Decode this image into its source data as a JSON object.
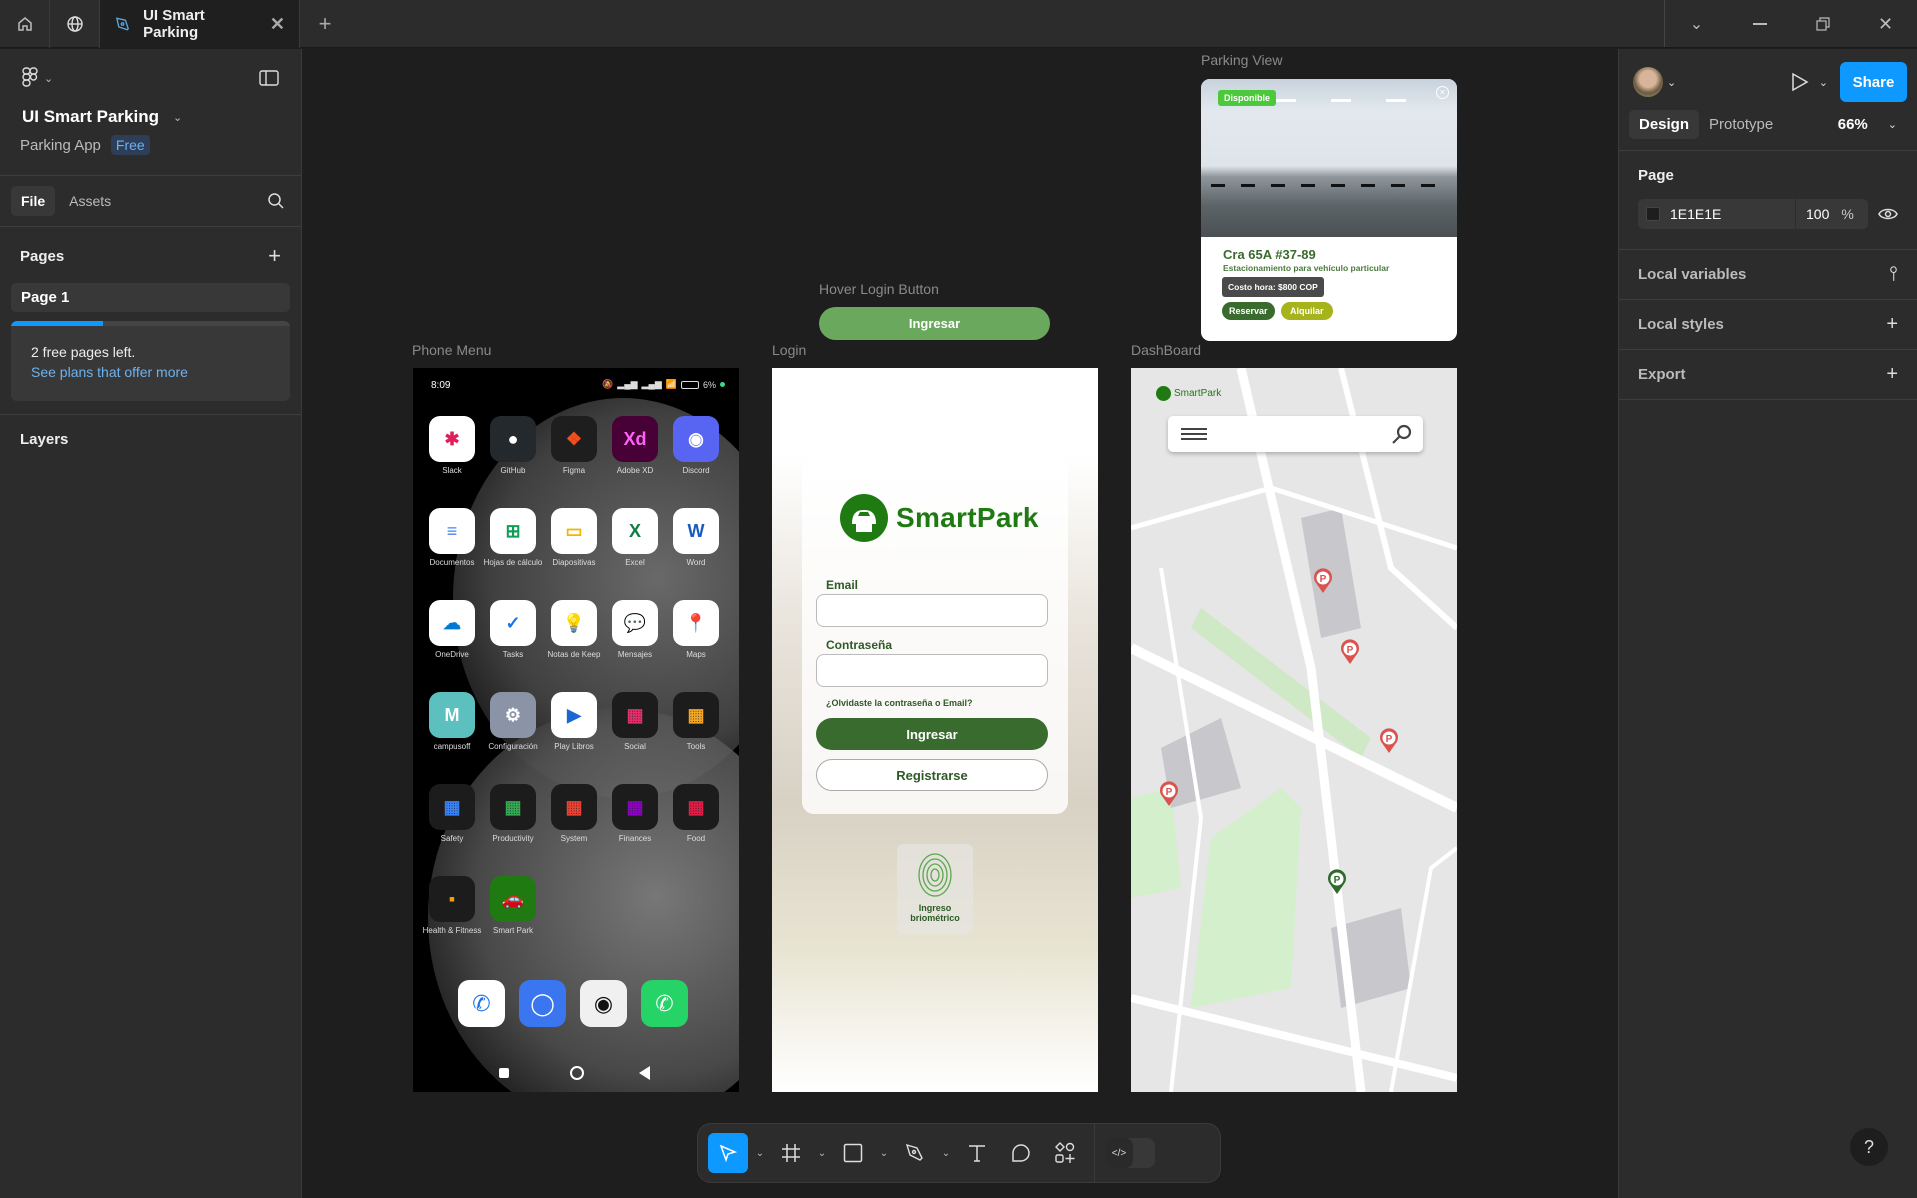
{
  "titlebar": {
    "tab_title": "UI Smart Parking",
    "icons": [
      "home-icon",
      "globe-icon",
      "pen-tool-icon",
      "close-icon",
      "plus-icon",
      "chevron-down-icon",
      "minimize-icon",
      "restore-icon",
      "close-window-icon"
    ]
  },
  "left_panel": {
    "file_name": "UI Smart Parking",
    "project": "Parking App",
    "plan_badge": "Free",
    "tabs": [
      {
        "label": "File",
        "active": true
      },
      {
        "label": "Assets",
        "active": false
      }
    ],
    "pages_title": "Pages",
    "pages": [
      {
        "label": "Page 1",
        "active": true
      }
    ],
    "free_pages_progress": 0.33,
    "free_pages_text": "2 free pages left.",
    "plans_link": "See plans that offer more",
    "layers_title": "Layers"
  },
  "right_panel": {
    "share_label": "Share",
    "tabs": [
      {
        "label": "Design",
        "active": true
      },
      {
        "label": "Prototype",
        "active": false
      }
    ],
    "zoom": "66%",
    "page_title": "Page",
    "page_color": "1E1E1E",
    "page_opacity": "100",
    "percent_sign": "%",
    "sections": [
      {
        "label": "Local variables",
        "icon": "sliders-icon"
      },
      {
        "label": "Local styles",
        "icon": "plus-icon"
      },
      {
        "label": "Export",
        "icon": "plus-icon"
      }
    ]
  },
  "canvas": {
    "frames": {
      "phone_menu": "Phone Menu",
      "login": "Login",
      "dashboard": "DashBoard",
      "hover_login": "Hover Login Button",
      "parking_view": "Parking View"
    },
    "phone": {
      "time": "8:09",
      "battery": "6%",
      "apps": [
        {
          "label": "Slack",
          "bg": "#ffffff",
          "fg": "#e01e5a",
          "glyph": "✱"
        },
        {
          "label": "GitHub",
          "bg": "#24292e",
          "fg": "#ffffff",
          "glyph": "●"
        },
        {
          "label": "Figma",
          "bg": "#1e1e1e",
          "fg": "#f24e1e",
          "glyph": "❖"
        },
        {
          "label": "Adobe XD",
          "bg": "#470137",
          "fg": "#ff61f6",
          "glyph": "Xd"
        },
        {
          "label": "Discord",
          "bg": "#5865f2",
          "fg": "#ffffff",
          "glyph": "◉"
        },
        {
          "label": "Documentos",
          "bg": "#ffffff",
          "fg": "#4285f4",
          "glyph": "≡"
        },
        {
          "label": "Hojas de cálculo",
          "bg": "#ffffff",
          "fg": "#0f9d58",
          "glyph": "⊞"
        },
        {
          "label": "Diapositivas",
          "bg": "#ffffff",
          "fg": "#f4b400",
          "glyph": "▭"
        },
        {
          "label": "Excel",
          "bg": "#ffffff",
          "fg": "#107c41",
          "glyph": "X"
        },
        {
          "label": "Word",
          "bg": "#ffffff",
          "fg": "#185abd",
          "glyph": "W"
        },
        {
          "label": "OneDrive",
          "bg": "#ffffff",
          "fg": "#0078d4",
          "glyph": "☁"
        },
        {
          "label": "Tasks",
          "bg": "#ffffff",
          "fg": "#1a73e8",
          "glyph": "✓"
        },
        {
          "label": "Notas de Keep",
          "bg": "#ffffff",
          "fg": "#fbbc04",
          "glyph": "💡"
        },
        {
          "label": "Mensajes",
          "bg": "#ffffff",
          "fg": "#1a73e8",
          "glyph": "💬"
        },
        {
          "label": "Maps",
          "bg": "#ffffff",
          "fg": "#ea4335",
          "glyph": "📍"
        },
        {
          "label": "campusoff",
          "bg": "#5bc0be",
          "fg": "#ffffff",
          "glyph": "M"
        },
        {
          "label": "Configuración",
          "bg": "#8a94a6",
          "fg": "#ffffff",
          "glyph": "⚙"
        },
        {
          "label": "Play Libros",
          "bg": "#ffffff",
          "fg": "#1967d2",
          "glyph": "▶"
        },
        {
          "label": "Social",
          "bg": "#1c1c1c",
          "fg": "#e1306c",
          "glyph": "▦"
        },
        {
          "label": "Tools",
          "bg": "#1c1c1c",
          "fg": "#f5a623",
          "glyph": "▦"
        },
        {
          "label": "Safety",
          "bg": "#1c1c1c",
          "fg": "#3b82f6",
          "glyph": "▦"
        },
        {
          "label": "Productivity",
          "bg": "#1c1c1c",
          "fg": "#34a853",
          "glyph": "▦"
        },
        {
          "label": "System",
          "bg": "#1c1c1c",
          "fg": "#ea4335",
          "glyph": "▦"
        },
        {
          "label": "Finances",
          "bg": "#1c1c1c",
          "fg": "#8a05be",
          "glyph": "▦"
        },
        {
          "label": "Food",
          "bg": "#1c1c1c",
          "fg": "#e11d48",
          "glyph": "▦"
        },
        {
          "label": "Health & Fitness",
          "bg": "#1c1c1c",
          "fg": "#f59e0b",
          "glyph": "▪"
        },
        {
          "label": "Smart Park",
          "bg": "#1f7a12",
          "fg": "#ffffff",
          "glyph": "🚗"
        }
      ],
      "dock": [
        {
          "name": "phone-app",
          "bg": "#ffffff",
          "fg": "#1a73e8",
          "glyph": "✆"
        },
        {
          "name": "signal-app",
          "bg": "#3a76f0",
          "fg": "#ffffff",
          "glyph": "◯"
        },
        {
          "name": "camera-app",
          "bg": "#f0f0f0",
          "fg": "#111111",
          "glyph": "◉"
        },
        {
          "name": "whatsapp-app",
          "bg": "#25d366",
          "fg": "#ffffff",
          "glyph": "✆"
        }
      ]
    },
    "login": {
      "brand": "SmartPark",
      "email_label": "Email",
      "password_label": "Contraseña",
      "forgot": "¿Olvidaste la contraseña o Email?",
      "login_button": "Ingresar",
      "register_button": "Registrarse",
      "biometric": "Ingreso briométrico"
    },
    "hover_button": "Ingresar",
    "parking_card": {
      "status": "Disponible",
      "address": "Cra 65A #37-89",
      "description": "Estacionamiento para vehículo particular",
      "price": "Costo hora: $800 COP",
      "reserve": "Reservar",
      "rent": "Alquilar"
    },
    "dashboard": {
      "brand": "SmartPark",
      "pins": [
        {
          "status": "occupied",
          "color": "#d9534f"
        },
        {
          "status": "occupied",
          "color": "#d9534f"
        },
        {
          "status": "occupied",
          "color": "#d9534f"
        },
        {
          "status": "occupied",
          "color": "#d9534f"
        },
        {
          "status": "available",
          "color": "#2e6b2a"
        }
      ]
    }
  },
  "toolbar": {
    "tools": [
      "move-tool",
      "frame-tool",
      "shape-tool",
      "pen-tool",
      "text-tool",
      "comment-tool",
      "actions-tool",
      "dev-mode-toggle"
    ]
  },
  "help_label": "?",
  "colors": {
    "accent": "#0d99ff",
    "brand_green": "#3a6b2e",
    "brand_green_light": "#6aa85e",
    "available": "#4cc93a",
    "rent": "#a6b31a"
  }
}
